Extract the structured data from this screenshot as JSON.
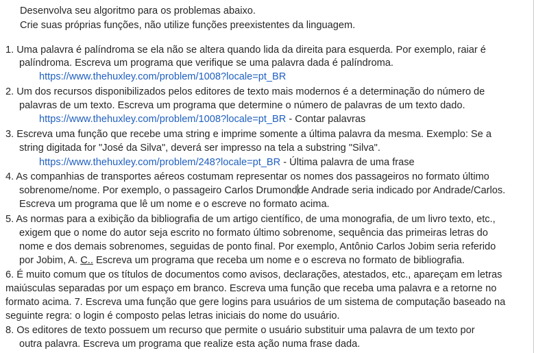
{
  "intro": {
    "line1": "Desenvolva seu algoritmo para os problemas abaixo.",
    "line2": "Crie suas próprias funções, não utilize funções preexistentes da linguagem."
  },
  "items": {
    "i1": {
      "l1": "1. Uma palavra é palíndroma se ela não se altera quando lida da direita para esquerda. Por exemplo, raiar é",
      "l2": "palíndroma. Escreva um programa que verifique se uma palavra dada é palíndroma.",
      "link": "https://www.thehuxley.com/problem/1008?locale=pt_BR"
    },
    "i2": {
      "l1": "2. Um dos recursos disponibilizados pelos editores de texto mais modernos é a determinação do número de",
      "l2": "palavras de um texto. Escreva um programa que determine o número de palavras de um texto dado.",
      "link": "https://www.thehuxley.com/problem/1008?locale=pt_BR",
      "link_suffix": " - Contar palavras"
    },
    "i3": {
      "l1": "3. Escreva uma função que recebe uma string e imprime somente a última palavra da mesma. Exemplo: Se a",
      "l2": "string digitada for \"José da Silva\", deverá ser impresso na tela a substring \"Silva\".",
      "link": "https://www.thehuxley.com/problem/248?locale=pt_BR",
      "link_suffix": " - Última palavra de uma frase"
    },
    "i4": {
      "l1": "4. As companhias de transportes aéreos costumam representar os nomes dos passageiros no formato último",
      "l2a": "sobrenome/nome. Por exemplo, o passageiro Carlos Drumond",
      "l2b": "de Andrade seria indicado por Andrade/Carlos.",
      "l3": "Escreva um programa que lê um nome e o escreve no formato acima."
    },
    "i5": {
      "l1": "5. As normas para a exibição da bibliografia de um artigo científico, de uma monografia, de um livro texto, etc.,",
      "l2": "exigem que o nome do autor seja escrito no formato último sobrenome, sequência das primeiras letras do",
      "l3": "nome e dos demais sobrenomes, seguidas de ponto final. Por exemplo, Antônio Carlos Jobim seria referido",
      "l4a": "por Jobim, A. ",
      "l4u": "C..",
      "l4b": " Escreva um programa que receba um nome e o escreva no formato de bibliografia."
    },
    "i6": {
      "l1": "6. É muito comum que os títulos de documentos como avisos, declarações, atestados, etc., apareçam em letras",
      "l2": "maiúsculas separadas por um espaço em branco. Escreva uma função que receba uma palavra e a retorne no",
      "l3": "formato acima. 7. Escreva uma função que gere logins para usuários de um sistema de computação baseado na",
      "l4": "seguinte regra: o login é composto pelas letras iniciais do nome do usuário."
    },
    "i8": {
      "l1": "8. Os editores de texto possuem um recurso que permite o usuário substituir uma palavra de um texto por",
      "l2": "outra palavra. Escreva um programa que realize esta ação numa frase dada."
    }
  }
}
